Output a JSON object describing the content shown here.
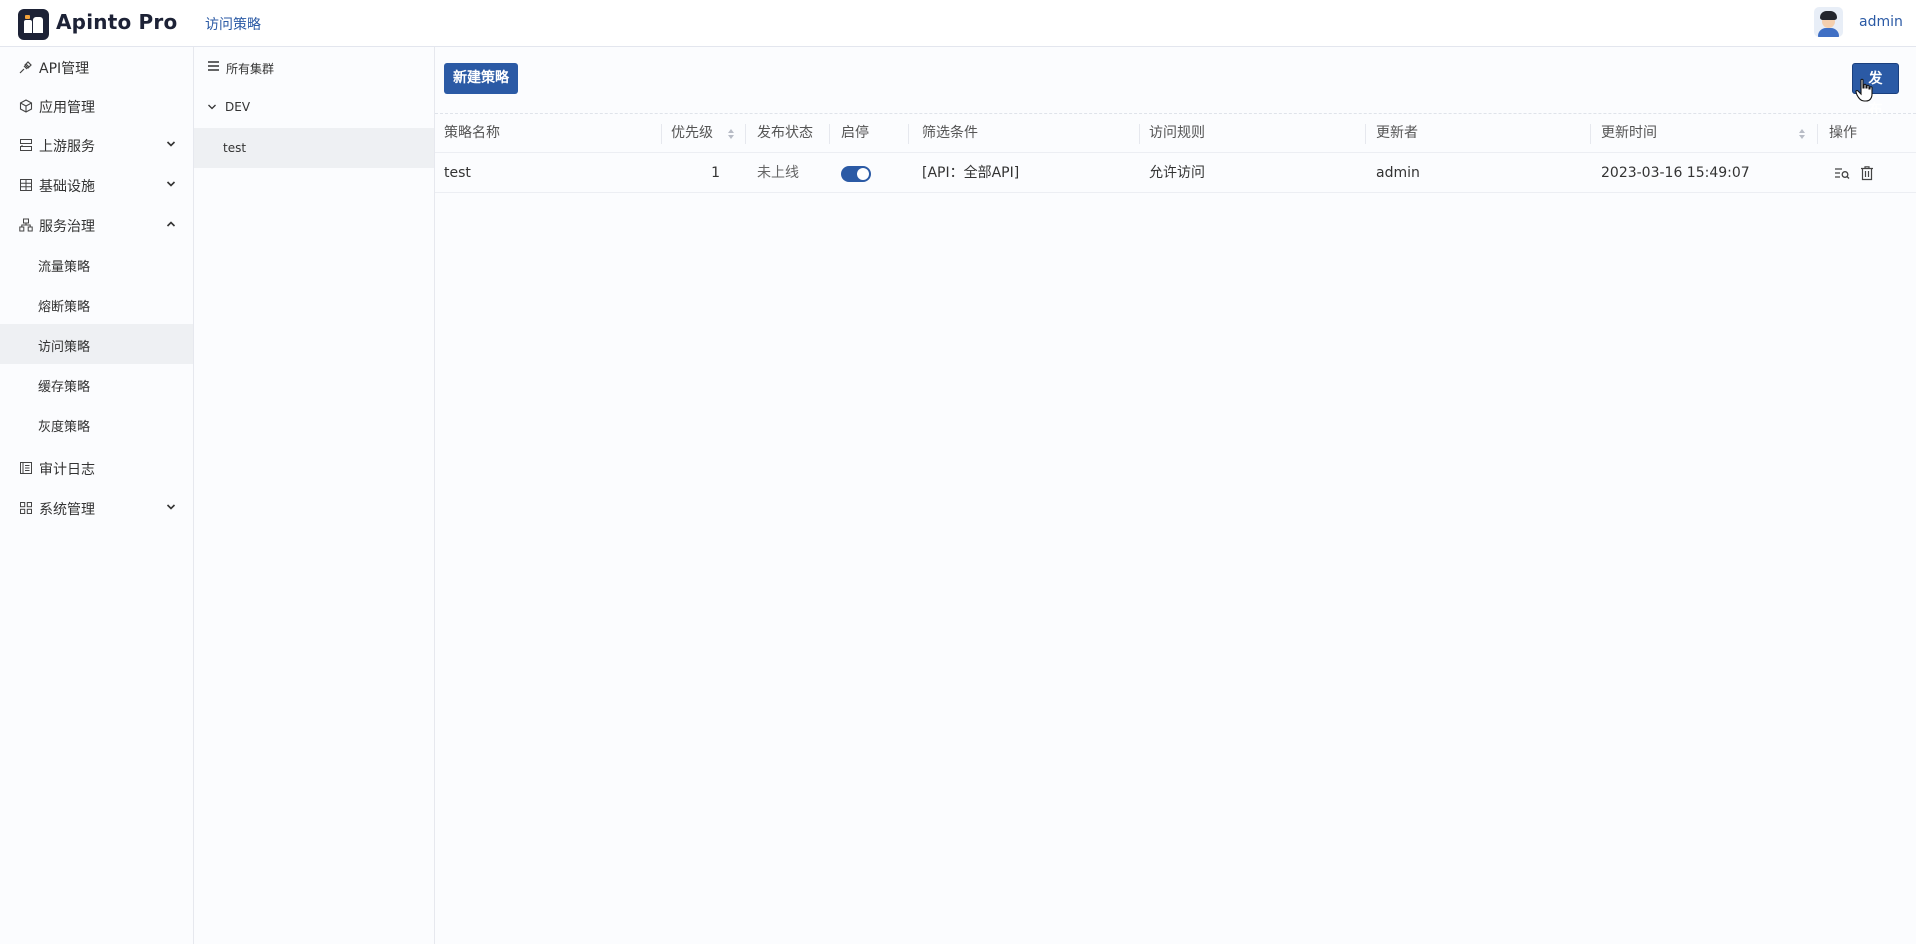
{
  "app": {
    "brand": "Apinto Pro",
    "breadcrumb": "访问策略",
    "user": "admin"
  },
  "sidebar": {
    "items": [
      {
        "label": "API管理",
        "icon": "plug-icon"
      },
      {
        "label": "应用管理",
        "icon": "cube-icon"
      },
      {
        "label": "上游服务",
        "icon": "server-icon",
        "expanded": false
      },
      {
        "label": "基础设施",
        "icon": "grid-icon",
        "expanded": false
      },
      {
        "label": "服务治理",
        "icon": "hierarchy-icon",
        "expanded": true
      },
      {
        "label": "审计日志",
        "icon": "log-icon"
      },
      {
        "label": "系统管理",
        "icon": "apps-icon",
        "expanded": false
      }
    ],
    "sub_items": [
      "流量策略",
      "熔断策略",
      "访问策略",
      "缓存策略",
      "灰度策略"
    ],
    "active_sub": "访问策略"
  },
  "clusters": {
    "all_label": "所有集群",
    "group": "DEV",
    "selected": "test"
  },
  "toolbar": {
    "new_label": "新建策略",
    "publish_label": "发布"
  },
  "table": {
    "columns": [
      "策略名称",
      "优先级",
      "发布状态",
      "启停",
      "筛选条件",
      "访问规则",
      "更新者",
      "更新时间",
      "操作"
    ],
    "rows": [
      {
        "name": "test",
        "priority": "1",
        "status": "未上线",
        "enabled": true,
        "filter": "[API：全部API]",
        "rule": "允许访问",
        "updater": "admin",
        "updated_at": "2023-03-16 15:49:07"
      }
    ]
  },
  "colors": {
    "primary": "#2b5aa5",
    "brand_dark": "#1d2236",
    "active_bg": "#eef0f3"
  }
}
